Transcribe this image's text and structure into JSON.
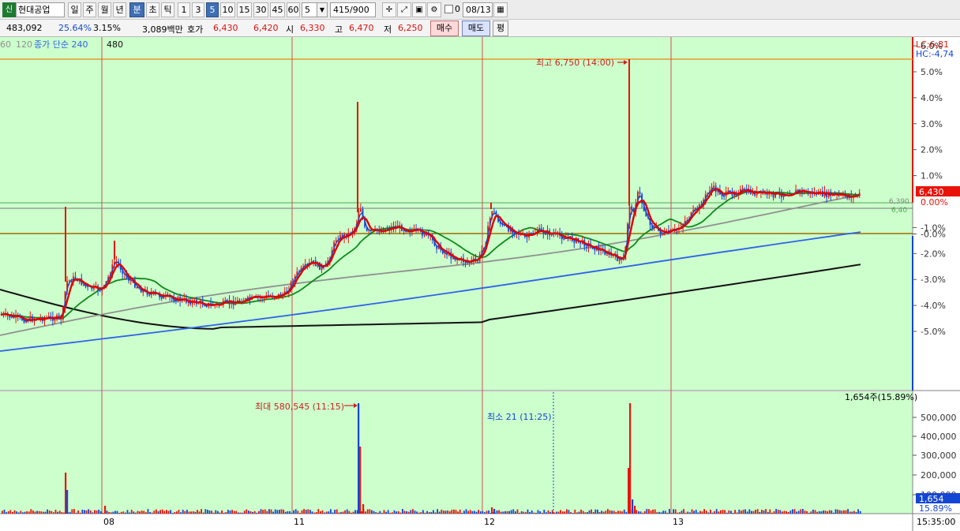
{
  "toolbar": {
    "code_icon": "신",
    "stock_name": "현대공업",
    "periods": [
      "일",
      "주",
      "월",
      "년",
      "분",
      "초",
      "틱"
    ],
    "active_period": "분",
    "intervals": [
      "1",
      "3",
      "5",
      "10",
      "15",
      "30",
      "45",
      "60"
    ],
    "active_interval": "5",
    "interval_value": "5",
    "count": "415",
    "count_total": "/900",
    "checkbox_label": "0",
    "date": "08/13",
    "icons": [
      "crosshair-icon",
      "expand-icon",
      "save-icon",
      "settings-icon"
    ]
  },
  "info": {
    "volume": "483,092",
    "turnover_rate": "25.64%",
    "change_pct": "3.15%",
    "amount": "3,089백만",
    "bid_label": "호가",
    "ask_price": "6,430",
    "bid_price": "6,420",
    "open_label": "시",
    "open": "6,330",
    "high_label": "고",
    "high": "6,470",
    "low_label": "저",
    "low": "6,250",
    "buy_label": "매수",
    "sell_label": "매도",
    "avg_label": "평"
  },
  "legend": {
    "ma60": "60",
    "ma120": "120",
    "ma240": "종가 단순 240",
    "ma480": "480"
  },
  "price_panel": {
    "lc": "LC:6,81",
    "hc": "HC:-4,74",
    "y_ticks": [
      "6.0%",
      "5.0%",
      "4.0%",
      "3.0%",
      "2.0%",
      "1.0%",
      "-0.0%",
      "-1.0%",
      "-2.0%",
      "-3.0%",
      "-4.0%",
      "-5.0%"
    ],
    "current_price": "6,430",
    "current_pct": "0.00%",
    "ref_upper": "6,390",
    "ref_lower": "6,40",
    "high_annotation": "최고 6,750 (14:00)"
  },
  "volume_panel": {
    "max_annotation": "최대 580,545 (11:15)",
    "min_annotation": "최소 21 (11:25)",
    "current_label": "1,654주(15.89%)",
    "y_ticks": [
      "500,000",
      "400,000",
      "300,000",
      "200,000",
      "100,000"
    ],
    "current_value": "1,654",
    "current_pct": "15.89%"
  },
  "x_axis": {
    "labels": [
      "08",
      "11",
      "12",
      "13"
    ],
    "time": "15:35:00"
  },
  "colors": {
    "chart_bg": "#ccffcc",
    "up": "#e8140a",
    "down": "#1446d6",
    "ma5": "#e00000",
    "ma20": "#0f8a1a",
    "ma60": "#909090",
    "ma120": "#2f63e8",
    "ma240": "#111111",
    "day_divider": "#d05050",
    "high_line": "#e89a2c",
    "prev_close_line": "#a06b00"
  }
}
